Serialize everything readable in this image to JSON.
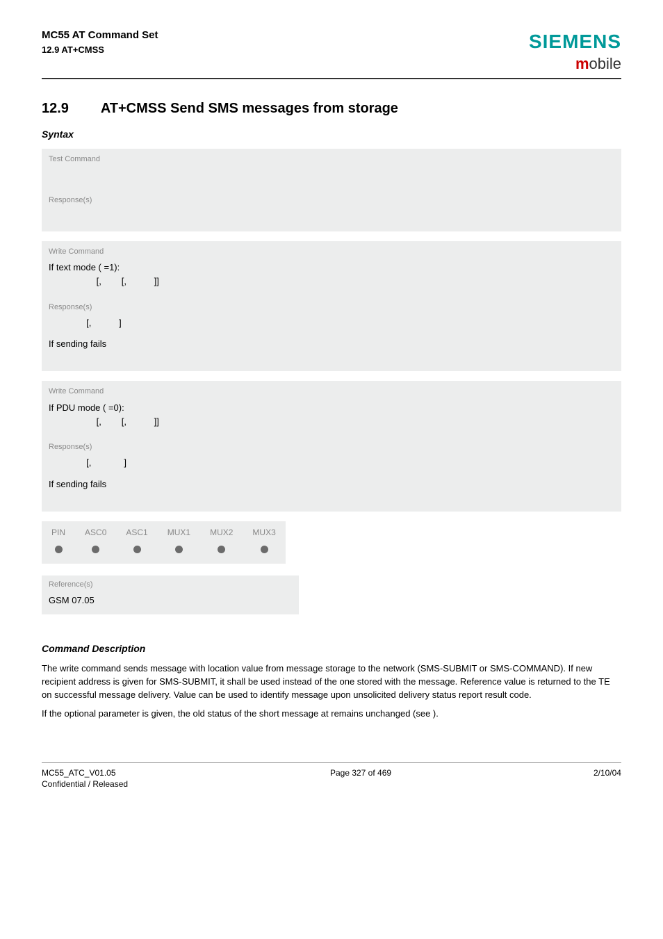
{
  "header": {
    "title": "MC55 AT Command Set",
    "subtitle": "12.9 AT+CMSS",
    "brand": "SIEMENS",
    "brand_sub_m": "m",
    "brand_sub_rest": "obile"
  },
  "section": {
    "number": "12.9",
    "title": "AT+CMSS   Send SMS messages from storage",
    "syntax_label": "Syntax"
  },
  "test_block": {
    "label": "Test Command",
    "resp_label": "Response(s)"
  },
  "write_text": {
    "label": "Write Command",
    "line1": "If text mode (             =1):",
    "line2": "                   [,        [,           ]]",
    "resp_label": "Response(s)",
    "resp_line": "               [,           ]",
    "fail": "If sending fails"
  },
  "write_pdu": {
    "label": "Write Command",
    "line1": "If PDU mode (             =0):",
    "line2": "                   [,        [,           ]]",
    "resp_label": "Response(s)",
    "resp_line": "               [,             ]",
    "fail": "If sending fails"
  },
  "pin_table": {
    "headers": [
      "PIN",
      "ASC0",
      "ASC1",
      "MUX1",
      "MUX2",
      "MUX3"
    ]
  },
  "reference": {
    "label": "Reference(s)",
    "value": "GSM 07.05"
  },
  "description": {
    "heading": "Command Description",
    "p1": "The write command sends message with location value             from message storage           to the network (SMS-SUBMIT or SMS-COMMAND). If new recipient address        is given for SMS-SUBMIT, it shall be used instead of the one stored with the message. Reference value          is returned to the TE on successful message delivery. Value can be used to identify message upon unsolicited delivery status report result code.",
    "p2": "If the optional parameter          is given, the old status of the short message at               remains unchanged (see             )."
  },
  "footer": {
    "left1": "MC55_ATC_V01.05",
    "left2": "Confidential / Released",
    "center": "Page 327 of 469",
    "right": "2/10/04"
  }
}
